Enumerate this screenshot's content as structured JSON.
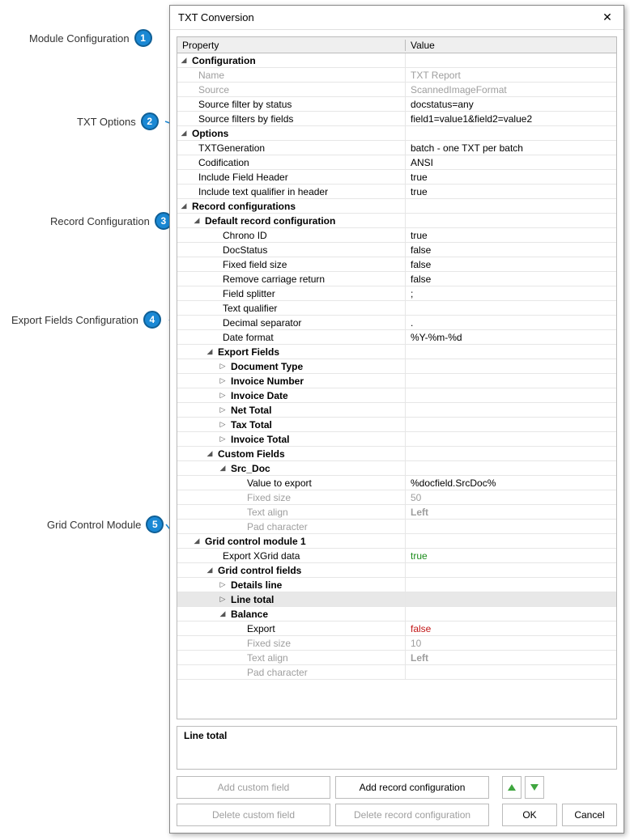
{
  "callouts": [
    {
      "label": "Module Configuration",
      "num": "1"
    },
    {
      "label": "TXT Options",
      "num": "2"
    },
    {
      "label": "Record Configuration",
      "num": "3"
    },
    {
      "label": "Export Fields Configuration",
      "num": "4"
    },
    {
      "label": "Grid Control Module",
      "num": "5"
    }
  ],
  "dialog": {
    "title": "TXT Conversion"
  },
  "headers": {
    "property": "Property",
    "value": "Value"
  },
  "rows": {
    "configuration": "Configuration",
    "name_prop": "Name",
    "name_val": "TXT Report",
    "source_prop": "Source",
    "source_val": "ScannedImageFormat",
    "sfstatus_prop": "Source filter by status",
    "sfstatus_val": "docstatus=any",
    "sffields_prop": "Source filters by fields",
    "sffields_val": "field1=value1&field2=value2",
    "options": "Options",
    "txtgen_prop": "TXTGeneration",
    "txtgen_val": "batch - one TXT per batch",
    "codif_prop": "Codification",
    "codif_val": "ANSI",
    "ifh_prop": "Include Field Header",
    "ifh_val": "true",
    "itqh_prop": "Include text qualifier in header",
    "itqh_val": "true",
    "recconfs": "Record configurations",
    "defrec": "Default record configuration",
    "chrono_prop": "Chrono ID",
    "chrono_val": "true",
    "docstatus_prop": "DocStatus",
    "docstatus_val": "false",
    "ffs_prop": "Fixed field size",
    "ffs_val": "false",
    "rcr_prop": "Remove carriage return",
    "rcr_val": "false",
    "fsplit_prop": "Field splitter",
    "fsplit_val": ";",
    "tq_prop": "Text qualifier",
    "tq_val": "",
    "dsep_prop": "Decimal separator",
    "dsep_val": ".",
    "dfmt_prop": "Date format",
    "dfmt_val": "%Y-%m-%d",
    "expfields": "Export Fields",
    "doctype": "Document Type",
    "invnum": "Invoice Number",
    "invdate": "Invoice Date",
    "nettotal": "Net Total",
    "taxtotal": "Tax Total",
    "invtotal": "Invoice Total",
    "custfields": "Custom Fields",
    "srcdoc": "Src_Doc",
    "vte_prop": "Value to export",
    "vte_val": "%docfield.SrcDoc%",
    "fsize_prop": "Fixed size",
    "fsize_val": "50",
    "talign_prop": "Text align",
    "talign_val": "Left",
    "padchar_prop": "Pad character",
    "padchar_val": "",
    "gcm": "Grid control module  1",
    "exg_prop": "Export XGrid data",
    "exg_val": "true",
    "gcf": "Grid control fields",
    "detline": "Details line",
    "linetotal": "Line total",
    "balance": "Balance",
    "export_prop": "Export",
    "export_val": "false",
    "fsize2_prop": "Fixed size",
    "fsize2_val": "10",
    "talign2_prop": "Text align",
    "talign2_val": "Left",
    "padchar2_prop": "Pad character",
    "padchar2_val": ""
  },
  "description": "Line total",
  "buttons": {
    "add_custom": "Add custom field",
    "add_record": "Add record configuration",
    "del_custom": "Delete custom field",
    "del_record": "Delete record configuration",
    "ok": "OK",
    "cancel": "Cancel"
  }
}
